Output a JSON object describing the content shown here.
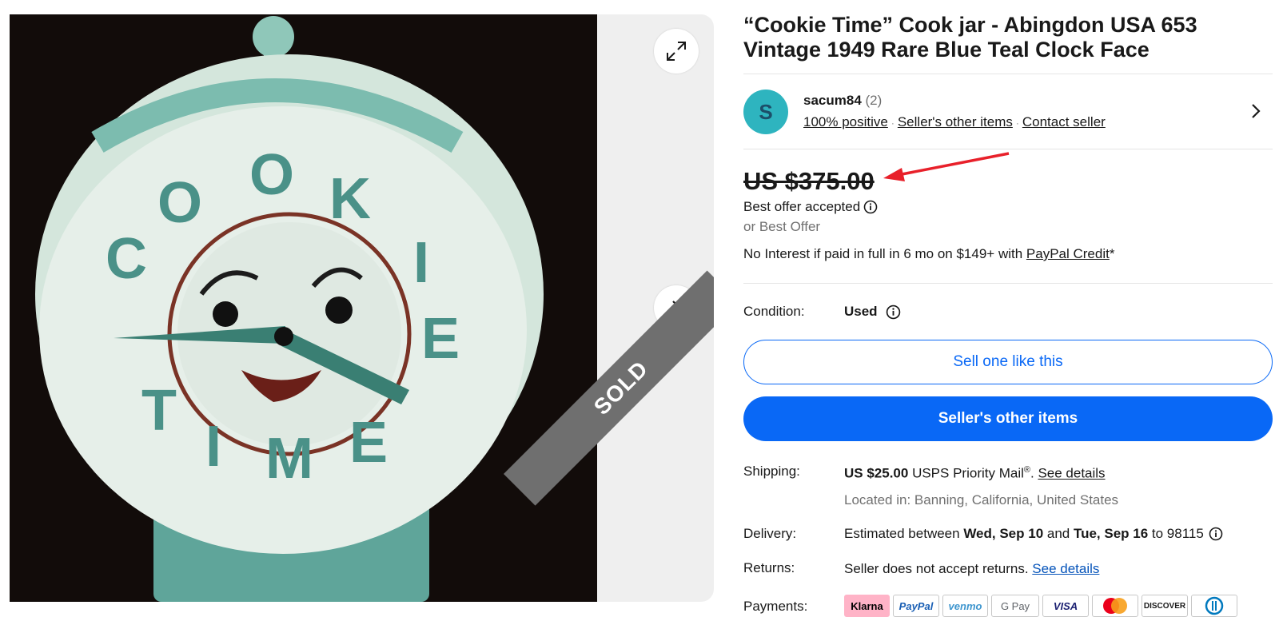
{
  "listing": {
    "title": "“Cookie Time” Cook jar - Abingdon USA 653 Vintage 1949 Rare Blue Teal Clock Face",
    "sold_label": "SOLD",
    "photo_lettering": [
      "C",
      "O",
      "O",
      "K",
      "I",
      "E",
      "T",
      "I",
      "M",
      "E"
    ]
  },
  "seller": {
    "avatar_letter": "S",
    "name": "sacum84",
    "feedback_count": "(2)",
    "positive_link": "100% positive",
    "other_items_link": "Seller's other items",
    "contact_link": "Contact seller"
  },
  "price": {
    "amount": "US $375.00",
    "status": "Best offer accepted",
    "or_best_offer": "or Best Offer",
    "financing_text": "No Interest if paid in full in 6 mo on $149+ with ",
    "financing_link": "PayPal Credit",
    "financing_suffix": "*"
  },
  "condition": {
    "label": "Condition:",
    "value": "Used"
  },
  "buttons": {
    "sell_one": "Sell one like this",
    "seller_items": "Seller's other items"
  },
  "shipping": {
    "label": "Shipping:",
    "price": "US $25.00",
    "service": " USPS Priority Mail",
    "reg": "®",
    "period": ". ",
    "details_link": "See details",
    "location": "Located in: Banning, California, United States"
  },
  "delivery": {
    "label": "Delivery:",
    "prefix": "Estimated between ",
    "start": "Wed, Sep 10",
    "middle": " and ",
    "end": "Tue, Sep 16",
    "suffix": " to 98115"
  },
  "returns": {
    "label": "Returns:",
    "text": "Seller does not accept returns. ",
    "details_link": "See details"
  },
  "payments": {
    "label": "Payments:",
    "methods": [
      "Klarna",
      "PayPal",
      "venmo",
      "G Pay",
      "VISA",
      "Mastercard",
      "DISCOVER",
      "Diners Club"
    ]
  },
  "colors": {
    "accent": "#0968f6",
    "link": "#0654ba",
    "avatar_bg": "#2eb4bf",
    "annotation_arrow": "#e8202a"
  }
}
